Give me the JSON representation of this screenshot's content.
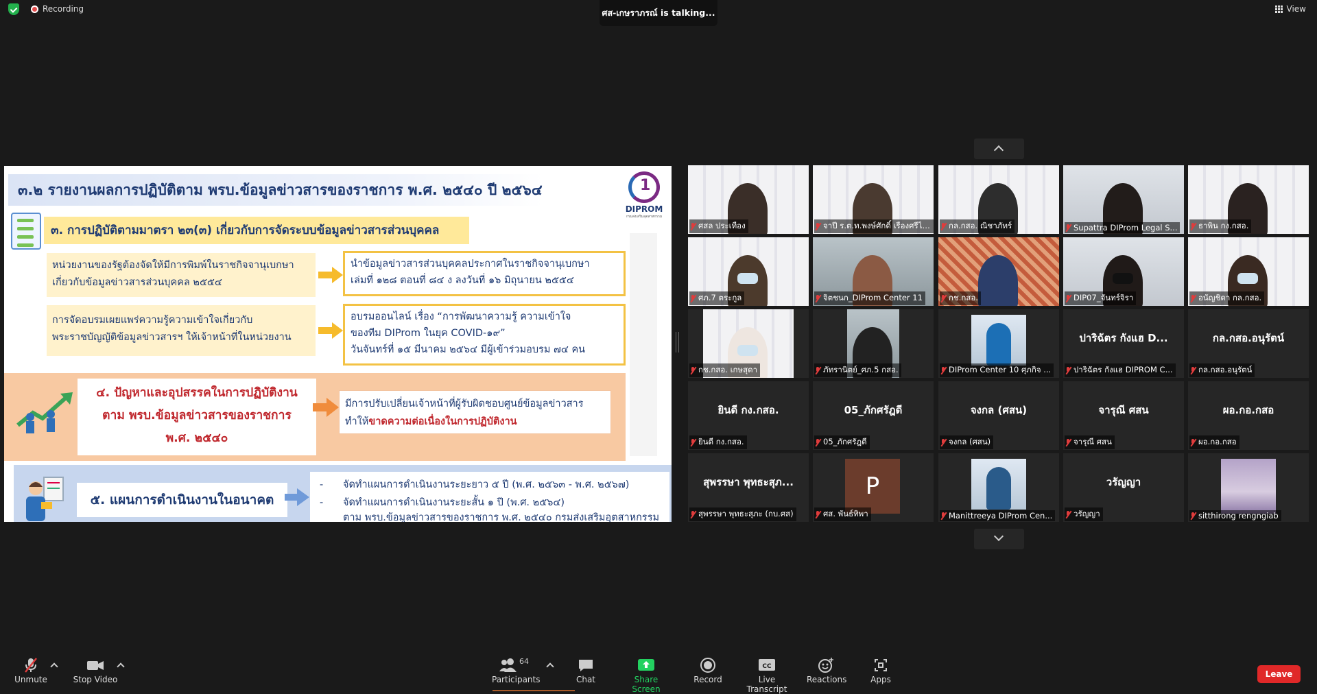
{
  "topbar": {
    "recording_label": "Recording",
    "talking_text": "ศส-เกษราภรณ์ is talking...",
    "view_label": "View"
  },
  "slide": {
    "title": "๓.๒ รายงานผลการปฏิบัติตาม พรบ.ข้อมูลข่าวสารของราชการ พ.ศ. ๒๕๔๐ ปี ๒๕๖๔",
    "logo_text": "DIPROM",
    "logo_sub": "กรมส่งเสริมอุตสาหกรรม",
    "section3": "๓. การปฏิบัติตามมาตรา ๒๓(๓) เกี่ยวกับการจัดระบบข้อมูลข่าวสารส่วนบุคคล",
    "row1_left_1": "หน่วยงานของรัฐต้องจัดให้มีการพิมพ์ในราชกิจจานุเบกษา",
    "row1_left_2": "เกี่ยวกับข้อมูลข่าวสารส่วนบุคคล ๒๕๕๔",
    "row1_right_1": "นำข้อมูลข่าวสารส่วนบุคคลประกาศในราชกิจจานุเบกษา",
    "row1_right_2": "เล่มที่ ๑๒๘ ตอนที่ ๘๔ ง ลงวันที่ ๑๖ มิถุนายน ๒๕๕๔",
    "row2_left_1": "การจัดอบรมเผยแพร่ความรู้ความเข้าใจเกี่ยวกับ",
    "row2_left_2": "พระราชบัญญัติข้อมูลข่าวสารฯ ให้เจ้าหน้าที่ในหน่วยงาน",
    "row2_right_1": "อบรมออนไลน์ เรื่อง “การพัฒนาความรู้ ความเข้าใจ",
    "row2_right_2": "ของทีม DIProm ในยุค COVID-๑๙”",
    "row2_right_3": "วันจันทร์ที่ ๑๕ มีนาคม ๒๕๖๔ มีผู้เข้าร่วมอบรม ๗๔ คน",
    "section4_1": "๔. ปัญหาและอุปสรรคในการปฏิบัติงาน",
    "section4_2": "ตาม พรบ.ข้อมูลข่าวสารของราชการ",
    "section4_3": "พ.ศ. ๒๕๔๐",
    "box4_1": "มีการปรับเปลี่ยนเจ้าหน้าที่ผู้รับผิดชอบศูนย์ข้อมูลข่าวสาร",
    "box4_2a": "ทำให้",
    "box4_2b": "ขาดความต่อเนื่องในการปฏิบัติงาน",
    "section5": "๕. แผนการดำเนินงานในอนาคต",
    "box5_1": "จัดทำแผนการดำเนินงานระยะยาว ๕ ปี (พ.ศ. ๒๕๖๓ - พ.ศ. ๒๕๖๗)",
    "box5_2": "จัดทำแผนการดำเนินงานระยะสั้น ๑ ปี (พ.ศ. ๒๕๖๔)",
    "box5_3": "ตาม พรบ.ข้อมูลข่าวสารของราชการ พ.ศ. ๒๕๔๐ กรมส่งเสริมอุตสาหกรรม",
    "dash": "-"
  },
  "gallery": {
    "tiles": [
      {
        "label": "ศสล ประเทือง",
        "video": "person"
      },
      {
        "label": "จาปี ร.ต.ท.พงษ์ศักดิ์ เรืองศรีไส...",
        "video": "person"
      },
      {
        "label": "กล.กสอ. ณิชาภัทร์",
        "video": "person"
      },
      {
        "label": "Supattra DIProm Legal S...",
        "video": "person"
      },
      {
        "label": "ธาพิน กง.กสอ.",
        "video": "person"
      },
      {
        "label": "ศภ.7 ตระกูล",
        "video": "person"
      },
      {
        "label": "จิตชนก_DIProm Center 11",
        "video": "person"
      },
      {
        "label": "กช.กสอ.",
        "video": "person"
      },
      {
        "label": "DIP07_จันทร์จิรา",
        "video": "person"
      },
      {
        "label": "อนัญชิดา กล.กสอ.",
        "video": "person"
      },
      {
        "label": "กช.กสอ. เกษสุดา",
        "video": "person"
      },
      {
        "label": "ภัทรานิตย์_ศภ.5 กสอ.",
        "video": "person"
      },
      {
        "label": "DIProm Center 10 ศุภกิจ ...",
        "video": "photo"
      },
      {
        "name": "ปาริฉัตร กังแฮ D...",
        "label": "ปาริฉัตร กังแฮ DIPROM C..."
      },
      {
        "name": "กล.กสอ.อนุรัตน์",
        "label": "กล.กสอ.อนุรัตน์"
      },
      {
        "name": "ยินดี กง.กสอ.",
        "label": "ยินดี กง.กสอ."
      },
      {
        "name": "05_ภักศรัฎดี",
        "label": "05_ภักศรัฎดี"
      },
      {
        "name": "จงกล (ศสน)",
        "label": "จงกล (ศสน)"
      },
      {
        "name": "จารุณี ศสน",
        "label": "จารุณี ศสน"
      },
      {
        "name": "ผอ.กอ.กสอ",
        "label": "ผอ.กอ.กสอ"
      },
      {
        "name": "สุพรรษา พุทธะสุภ...",
        "label": "สุพรรษา พุทธะสุภะ (กบ.ศส)"
      },
      {
        "avatar": "P",
        "label": "ศส. พันธ์ทิพา"
      },
      {
        "label": "Manittreeya DIProm Cen...",
        "video": "photo"
      },
      {
        "name": "วรัญญา",
        "label": "วรัญญา"
      },
      {
        "label": "sitthirong rengngiab",
        "video": "landscape"
      }
    ]
  },
  "toolbar": {
    "unmute": "Unmute",
    "stop_video": "Stop Video",
    "participants": "Participants",
    "participants_count": "64",
    "chat": "Chat",
    "share_screen": "Share Screen",
    "record": "Record",
    "live_transcript": "Live Transcript",
    "cc_text": "CC",
    "reactions": "Reactions",
    "apps": "Apps",
    "leave": "Leave"
  },
  "colors": {
    "accent_green": "#23d160",
    "leave_red": "#e02828",
    "slide_navy": "#1f3b73",
    "slide_red": "#c0282e"
  }
}
